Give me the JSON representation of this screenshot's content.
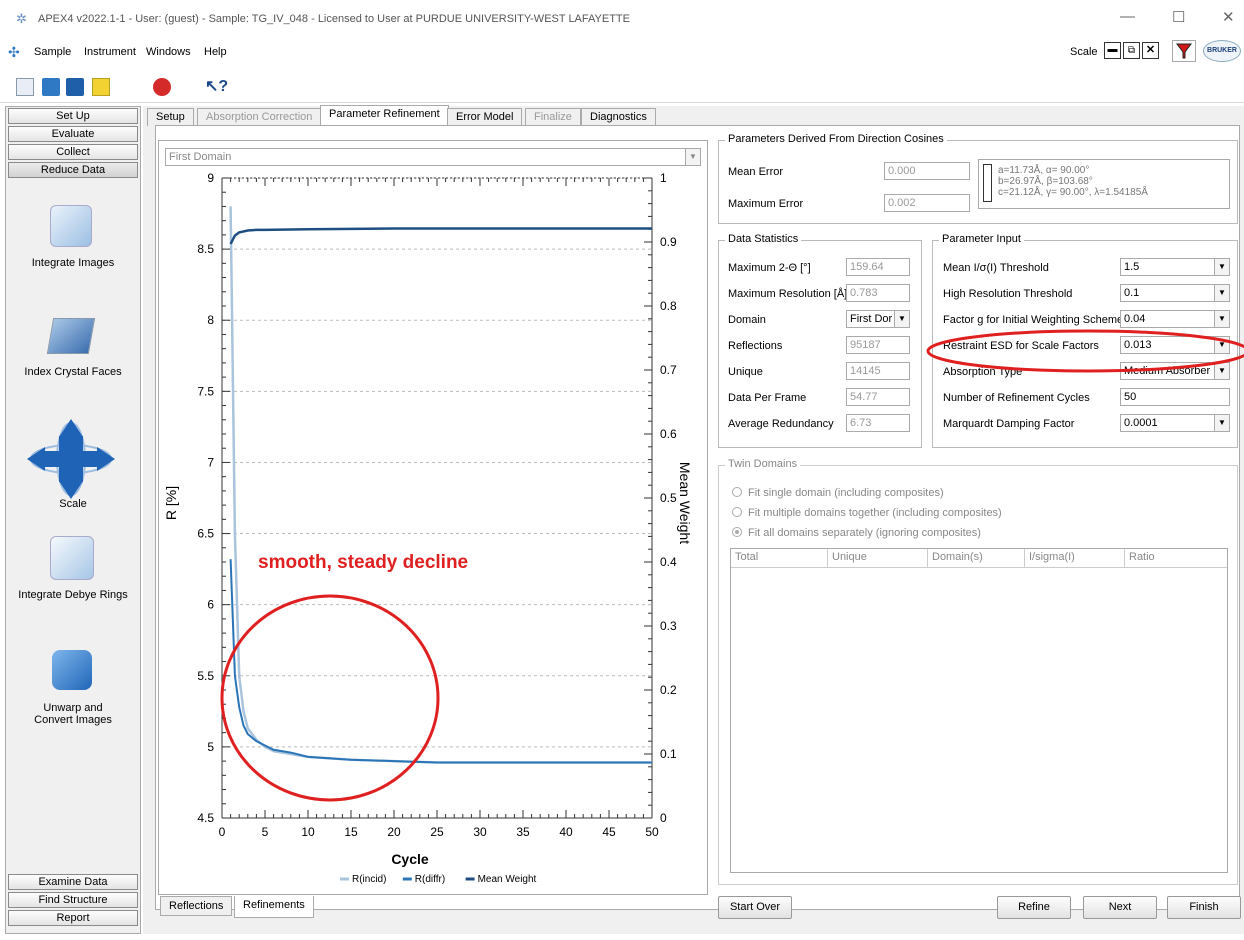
{
  "window": {
    "title": "APEX4 v2022.1-1 - User: (guest) - Sample: TG_IV_048 - Licensed to User at PURDUE UNIVERSITY-WEST LAFAYETTE",
    "min": "—",
    "max": "☐",
    "close": "✕"
  },
  "menu": {
    "items": [
      "Sample",
      "Instrument",
      "Windows",
      "Help"
    ],
    "scale_label": "Scale",
    "logo": "BRUKER"
  },
  "sidebar": {
    "top": [
      "Set Up",
      "Evaluate",
      "Collect",
      "Reduce Data"
    ],
    "tasks": [
      "Integrate Images",
      "Index Crystal Faces",
      "Scale",
      "Integrate Debye Rings",
      "Unwarp and Convert Images"
    ],
    "bottom": [
      "Examine Data",
      "Find Structure",
      "Report"
    ]
  },
  "tabs": [
    "Setup",
    "Absorption Correction",
    "Parameter Refinement",
    "Error Model",
    "Finalize",
    "Diagnostics"
  ],
  "bottom_tabs": [
    "Reflections",
    "Refinements"
  ],
  "chart_domain_select": "First Domain",
  "annotation": {
    "text": "smooth, steady decline",
    "color": "#e02020"
  },
  "direction_cosines": {
    "title": "Parameters Derived From Direction Cosines",
    "mean_error_label": "Mean Error",
    "mean_error": "0.000",
    "max_error_label": "Maximum Error",
    "max_error": "0.002",
    "cell_line1": "a=11.73Å,  α=  90.00°",
    "cell_line2": "b=26.97Å,  β=103.68°",
    "cell_line3": "c=21.12Å,  γ=  90.00°,  λ=1.54185Å"
  },
  "data_stats": {
    "title": "Data Statistics",
    "rows": [
      {
        "label": "Maximum 2-Θ [°]",
        "value": "159.64"
      },
      {
        "label": "Maximum Resolution [Å]",
        "value": "0.783"
      },
      {
        "label": "Domain",
        "value": "First Dor"
      },
      {
        "label": "Reflections",
        "value": "95187"
      },
      {
        "label": "Unique",
        "value": "14145"
      },
      {
        "label": "Data Per Frame",
        "value": "54.77"
      },
      {
        "label": "Average Redundancy",
        "value": "6.73"
      }
    ]
  },
  "param_input": {
    "title": "Parameter Input",
    "rows": [
      {
        "label": "Mean I/σ(I) Threshold",
        "value": "1.5"
      },
      {
        "label": "High Resolution Threshold",
        "value": "0.1"
      },
      {
        "label": "Factor g for Initial Weighting Scheme",
        "value": "0.04"
      },
      {
        "label": "Restraint ESD for Scale Factors",
        "value": "0.013"
      },
      {
        "label": "Absorption Type",
        "value": "Medium Absorber"
      },
      {
        "label": "Number of Refinement Cycles",
        "value": "50"
      },
      {
        "label": "Marquardt Damping Factor",
        "value": "0.0001"
      }
    ]
  },
  "twin": {
    "title": "Twin Domains",
    "options": [
      "Fit single domain (including composites)",
      "Fit multiple domains together (including composites)",
      "Fit all domains separately (ignoring composites)"
    ],
    "selected": 2,
    "columns": [
      "Total",
      "Unique",
      "Domain(s)",
      "I/sigma(I)",
      "Ratio"
    ]
  },
  "buttons": {
    "start_over": "Start Over",
    "refine": "Refine",
    "next": "Next",
    "finish": "Finish"
  },
  "chart_data": {
    "type": "line",
    "xlabel": "Cycle",
    "ylabel": "R [%]",
    "y2label": "Mean Weight",
    "xlim": [
      0,
      50
    ],
    "ylim": [
      4.5,
      9
    ],
    "y2lim": [
      0,
      1
    ],
    "xticks": [
      "0",
      "5",
      "10",
      "15",
      "20",
      "25",
      "30",
      "35",
      "40",
      "45",
      "50"
    ],
    "yticks": [
      "4.5",
      "5",
      "5.5",
      "6",
      "6.5",
      "7",
      "7.5",
      "8",
      "8.5",
      "9"
    ],
    "y2ticks": [
      "0",
      "0.1",
      "0.2",
      "0.3",
      "0.4",
      "0.5",
      "0.6",
      "0.7",
      "0.8",
      "0.9",
      "1"
    ],
    "legend": "bottom",
    "series": [
      {
        "name": "R(incid)",
        "axis": "left",
        "color": "#a9c4dc",
        "x": [
          1,
          1.5,
          2,
          2.5,
          3,
          4,
          5,
          6,
          8,
          10,
          15,
          20,
          25,
          30,
          40,
          50
        ],
        "y": [
          8.8,
          6.5,
          5.5,
          5.25,
          5.13,
          5.05,
          5.0,
          4.97,
          4.95,
          4.93,
          4.91,
          4.9,
          4.89,
          4.89,
          4.89,
          4.89
        ]
      },
      {
        "name": "R(diffr)",
        "axis": "left",
        "color": "#2a74b8",
        "x": [
          1,
          1.5,
          2,
          2.5,
          3,
          4,
          5,
          6,
          8,
          10,
          15,
          20,
          25,
          30,
          40,
          50
        ],
        "y": [
          6.32,
          5.5,
          5.28,
          5.15,
          5.09,
          5.04,
          5.01,
          4.98,
          4.96,
          4.93,
          4.91,
          4.9,
          4.89,
          4.89,
          4.89,
          4.89
        ]
      },
      {
        "name": "Mean Weight",
        "axis": "right",
        "color": "#1f4f82",
        "x": [
          1,
          1.5,
          2,
          3,
          4,
          5,
          10,
          20,
          30,
          40,
          50
        ],
        "y": [
          0.897,
          0.91,
          0.915,
          0.918,
          0.919,
          0.919,
          0.92,
          0.921,
          0.921,
          0.921,
          0.921
        ]
      }
    ]
  }
}
